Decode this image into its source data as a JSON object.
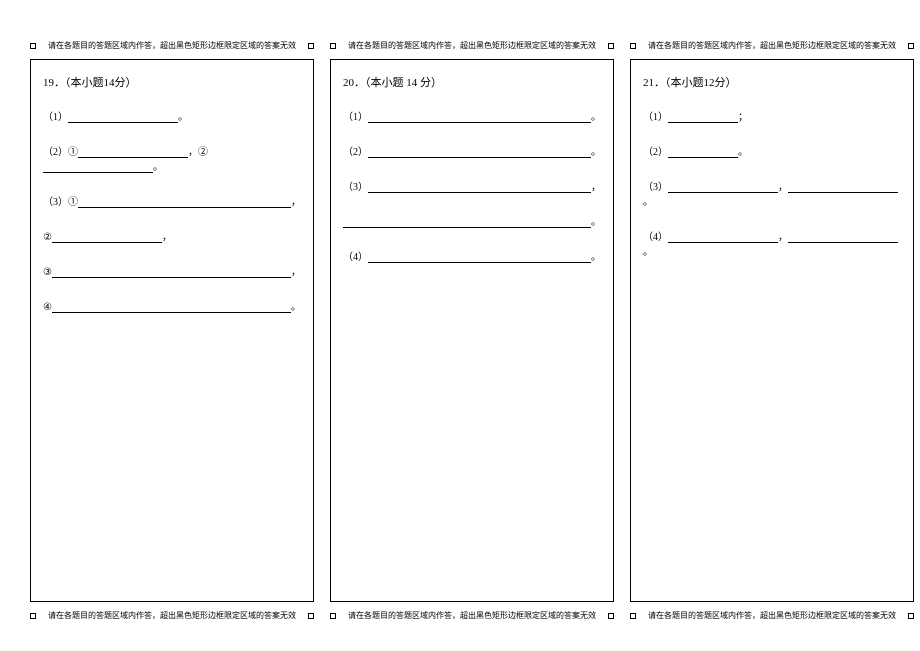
{
  "instruction_text": "请在各题目的答题区域内作答，超出黑色矩形边框限定区域的答案无效",
  "columns": [
    {
      "title": "19．（本小题14分）",
      "lines": [
        {
          "parts": [
            "（1）",
            {
              "blank": "med"
            },
            "。"
          ]
        },
        {
          "parts": [
            "（2）①",
            {
              "blank": "med"
            },
            "，②",
            {
              "blank": "med"
            },
            "。"
          ]
        },
        {
          "parts": [
            "（3）①",
            {
              "blank": "xlong"
            },
            "，"
          ]
        },
        {
          "parts": [
            "②",
            {
              "blank": "med"
            },
            "，"
          ]
        },
        {
          "parts": [
            "③",
            {
              "blank": "xlong"
            },
            "，"
          ]
        },
        {
          "parts": [
            "④",
            {
              "blank": "xlong"
            },
            "。"
          ]
        }
      ]
    },
    {
      "title": "20．（本小题 14 分）",
      "lines": [
        {
          "parts": [
            "（1）",
            {
              "blank": "xlong"
            },
            "。"
          ]
        },
        {
          "parts": [
            "（2）",
            {
              "blank": "xlong"
            },
            "。"
          ]
        },
        {
          "parts": [
            "（3）",
            {
              "blank": "xlong"
            },
            "，"
          ]
        },
        {
          "parts": [
            {
              "blank": "xlong"
            },
            "。"
          ]
        },
        {
          "parts": [
            "（4）",
            {
              "blank": "xlong"
            },
            "。"
          ]
        }
      ]
    },
    {
      "title": "21．（本小题12分）",
      "lines": [
        {
          "parts": [
            "（1）",
            {
              "blank": "short"
            },
            "；"
          ]
        },
        {
          "parts": [
            "（2）",
            {
              "blank": "short"
            },
            "。"
          ]
        },
        {
          "parts": [
            "（3）",
            {
              "blank": "med"
            },
            "，",
            {
              "blank": "med"
            },
            "。"
          ]
        },
        {
          "parts": [
            "（4）",
            {
              "blank": "med"
            },
            "，",
            {
              "blank": "med"
            },
            "。"
          ]
        }
      ]
    }
  ]
}
